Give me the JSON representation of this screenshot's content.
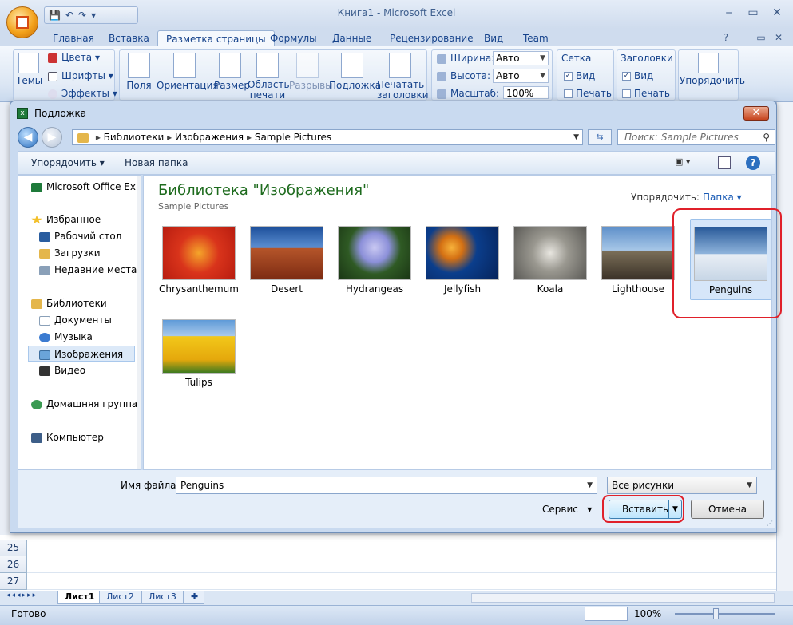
{
  "app": {
    "title": "Книга1 - Microsoft Excel",
    "qat": [
      "💾",
      "↶",
      "↷",
      "▾"
    ]
  },
  "ribbon": {
    "tabs": [
      "Главная",
      "Вставка",
      "Разметка страницы",
      "Формулы",
      "Данные",
      "Рецензирование",
      "Вид",
      "Team"
    ],
    "active_tab": "Разметка страницы",
    "themes": {
      "label": "Темы",
      "colors": "Цвета",
      "fonts": "Шрифты",
      "effects": "Эффекты"
    },
    "page_setup": [
      "Поля",
      "Ориентация",
      "Размер",
      "Область печати",
      "Разрывы",
      "Подложка",
      "Печатать заголовки"
    ],
    "scale": {
      "width_label": "Ширина:",
      "width_value": "Авто",
      "height_label": "Высота:",
      "height_value": "Авто",
      "scale_label": "Масштаб:",
      "scale_value": "100%"
    },
    "gridlines": {
      "title": "Сетка",
      "view": "Вид",
      "print": "Печать"
    },
    "headings": {
      "title": "Заголовки",
      "view": "Вид",
      "print": "Печать"
    },
    "arrange": "Упорядочить"
  },
  "grid": {
    "rows": [
      "25",
      "26",
      "27"
    ]
  },
  "sheets": [
    "Лист1",
    "Лист2",
    "Лист3"
  ],
  "status": {
    "text": "Готово",
    "zoom": "100%"
  },
  "dialog": {
    "title": "Подложка",
    "breadcrumb": [
      "Библиотеки",
      "Изображения",
      "Sample Pictures"
    ],
    "search_placeholder": "Поиск: Sample Pictures",
    "toolbar": {
      "organize": "Упорядочить",
      "new_folder": "Новая папка"
    },
    "nav": {
      "top": "Microsoft Office Ex",
      "favorites": "Избранное",
      "desktop": "Рабочий стол",
      "downloads": "Загрузки",
      "recent": "Недавние места",
      "libraries": "Библиотеки",
      "documents": "Документы",
      "music": "Музыка",
      "pictures": "Изображения",
      "video": "Видео",
      "homegroup": "Домашняя группа",
      "computer": "Компьютер"
    },
    "library_title": "Библиотека \"Изображения\"",
    "library_sub": "Sample Pictures",
    "sort_label": "Упорядочить:",
    "sort_value": "Папка",
    "files": [
      "Chrysanthemum",
      "Desert",
      "Hydrangeas",
      "Jellyfish",
      "Koala",
      "Lighthouse",
      "Penguins",
      "Tulips"
    ],
    "selected_file": "Penguins",
    "filename_label": "Имя файла:",
    "filename_value": "Penguins",
    "filetype": "Все рисунки",
    "tools": "Сервис",
    "insert": "Вставить",
    "cancel": "Отмена"
  },
  "colors": {
    "highlight": "#e0202a",
    "library_title": "#1e6b1e",
    "ribbon_text": "#15428b"
  }
}
